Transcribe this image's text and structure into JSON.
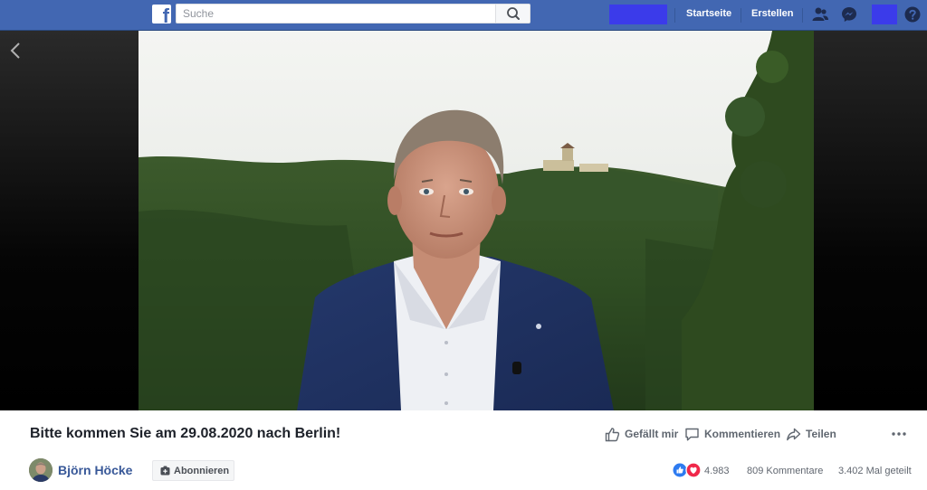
{
  "topbar": {
    "logo_letter": "f",
    "search_placeholder": "Suche",
    "nav": {
      "home": "Startseite",
      "create": "Erstellen"
    },
    "colors": {
      "bar": "#4267b2",
      "redaction": "#3b3bea"
    }
  },
  "post": {
    "title": "Bitte kommen Sie am 29.08.2020 nach Berlin!",
    "author": "Björn Höcke",
    "subscribe_label": "Abonnieren",
    "actions": {
      "like": "Gefällt mir",
      "comment": "Kommentieren",
      "share": "Teilen"
    },
    "stats": {
      "reactions": "4.983",
      "comments": "809 Kommentare",
      "shares": "3.402 Mal geteilt"
    }
  }
}
